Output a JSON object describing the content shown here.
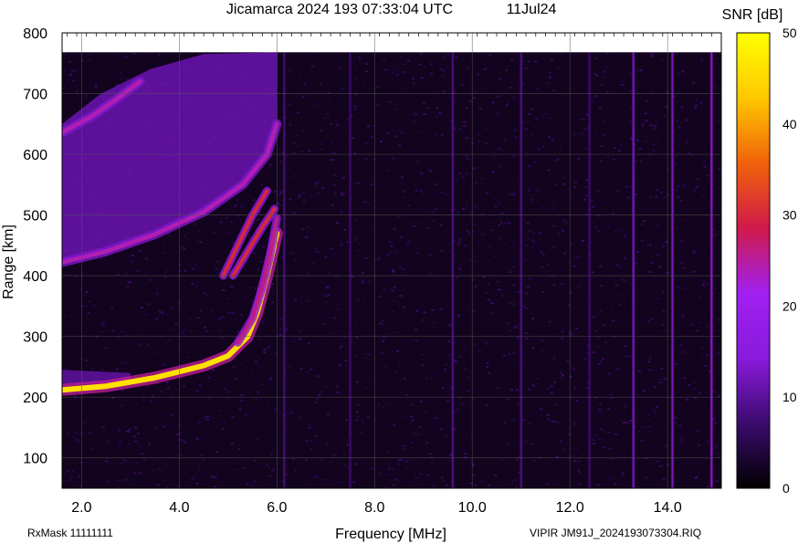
{
  "header": {
    "title": "Jicamarca 2024 193 07:33:04 UTC",
    "date": "11Jul24"
  },
  "footer": {
    "rx_mask": "RxMask 11111111",
    "file_label": "VIPIR  JM91J_2024193073304.RIQ"
  },
  "colorbar": {
    "label": "SNR [dB]",
    "ticks": [
      0,
      10,
      20,
      30,
      40,
      50
    ],
    "range": [
      0,
      50
    ],
    "colors": [
      "#000000",
      "#3c0b6e",
      "#8a1adc",
      "#a020f0",
      "#d01a4a",
      "#f0620a",
      "#ffc800",
      "#ffff00"
    ]
  },
  "chart_data": {
    "type": "heatmap",
    "xlabel": "Frequency [MHz]",
    "ylabel": "Range [km]",
    "xlim": [
      1.6,
      15.1
    ],
    "ylim": [
      50,
      800
    ],
    "data_top_km": 768,
    "x_ticks": [
      {
        "value": 2.0,
        "label": "2.0"
      },
      {
        "value": 4.0,
        "label": "4.0"
      },
      {
        "value": 6.0,
        "label": "6.0"
      },
      {
        "value": 8.0,
        "label": "8.0"
      },
      {
        "value": 10.0,
        "label": "10.0"
      },
      {
        "value": 12.0,
        "label": "12.0"
      },
      {
        "value": 14.0,
        "label": "14.0"
      }
    ],
    "y_ticks": [
      {
        "value": 100,
        "label": "100"
      },
      {
        "value": 200,
        "label": "200"
      },
      {
        "value": 300,
        "label": "300"
      },
      {
        "value": 400,
        "label": "400"
      },
      {
        "value": 500,
        "label": "500"
      },
      {
        "value": 600,
        "label": "600"
      },
      {
        "value": 700,
        "label": "700"
      },
      {
        "value": 800,
        "label": "800"
      }
    ],
    "grid": true,
    "traces": [
      {
        "name": "F-region O-mode trace",
        "snr": 46,
        "width_km": 9,
        "points": [
          [
            1.6,
            212
          ],
          [
            2.5,
            218
          ],
          [
            3.5,
            232
          ],
          [
            4.5,
            252
          ],
          [
            5.0,
            268
          ],
          [
            5.4,
            300
          ],
          [
            5.6,
            340
          ],
          [
            5.8,
            400
          ],
          [
            6.0,
            470
          ]
        ]
      },
      {
        "name": "F-region X-mode trace",
        "snr": 26,
        "width_km": 6,
        "points": [
          [
            5.2,
            290
          ],
          [
            5.5,
            330
          ],
          [
            5.7,
            380
          ],
          [
            5.85,
            430
          ],
          [
            6.0,
            495
          ]
        ]
      },
      {
        "name": "cusp trace",
        "snr": 30,
        "width_km": 6,
        "points": [
          [
            4.9,
            400
          ],
          [
            5.2,
            450
          ],
          [
            5.5,
            500
          ],
          [
            5.8,
            540
          ]
        ]
      },
      {
        "name": "cusp trace 2",
        "snr": 30,
        "width_km": 6,
        "points": [
          [
            5.1,
            400
          ],
          [
            5.4,
            440
          ],
          [
            5.7,
            480
          ],
          [
            5.95,
            510
          ]
        ]
      },
      {
        "name": "multi-hop echo",
        "snr": 24,
        "width_km": 7,
        "points": [
          [
            1.6,
            422
          ],
          [
            2.5,
            440
          ],
          [
            3.5,
            468
          ],
          [
            4.5,
            505
          ],
          [
            5.3,
            550
          ],
          [
            5.8,
            600
          ],
          [
            6.0,
            650
          ]
        ]
      },
      {
        "name": "upper echo",
        "snr": 24,
        "width_km": 7,
        "points": [
          [
            1.6,
            636
          ],
          [
            2.2,
            662
          ],
          [
            2.7,
            690
          ],
          [
            3.2,
            720
          ]
        ]
      }
    ],
    "diffuse_regions": [
      {
        "name": "spread echo band",
        "snr": 12,
        "lower": [
          [
            1.6,
            422
          ],
          [
            2.5,
            440
          ],
          [
            3.5,
            468
          ],
          [
            4.5,
            505
          ],
          [
            5.3,
            550
          ],
          [
            5.8,
            600
          ],
          [
            6.0,
            650
          ]
        ],
        "upper": [
          [
            1.6,
            650
          ],
          [
            2.4,
            700
          ],
          [
            3.4,
            740
          ],
          [
            4.5,
            765
          ],
          [
            6.0,
            768
          ]
        ]
      },
      {
        "name": "E-region patch",
        "snr": 11,
        "lower": [
          [
            1.6,
            220
          ],
          [
            3.0,
            225
          ]
        ],
        "upper": [
          [
            1.6,
            245
          ],
          [
            3.0,
            240
          ]
        ]
      }
    ],
    "interference_lines": [
      {
        "freq": 13.3,
        "snr": 15
      },
      {
        "freq": 14.1,
        "snr": 18
      },
      {
        "freq": 14.9,
        "snr": 22
      },
      {
        "freq": 11.0,
        "snr": 10
      },
      {
        "freq": 9.6,
        "snr": 10
      },
      {
        "freq": 7.5,
        "snr": 8
      },
      {
        "freq": 6.15,
        "snr": 9
      },
      {
        "freq": 12.4,
        "snr": 8
      }
    ]
  }
}
